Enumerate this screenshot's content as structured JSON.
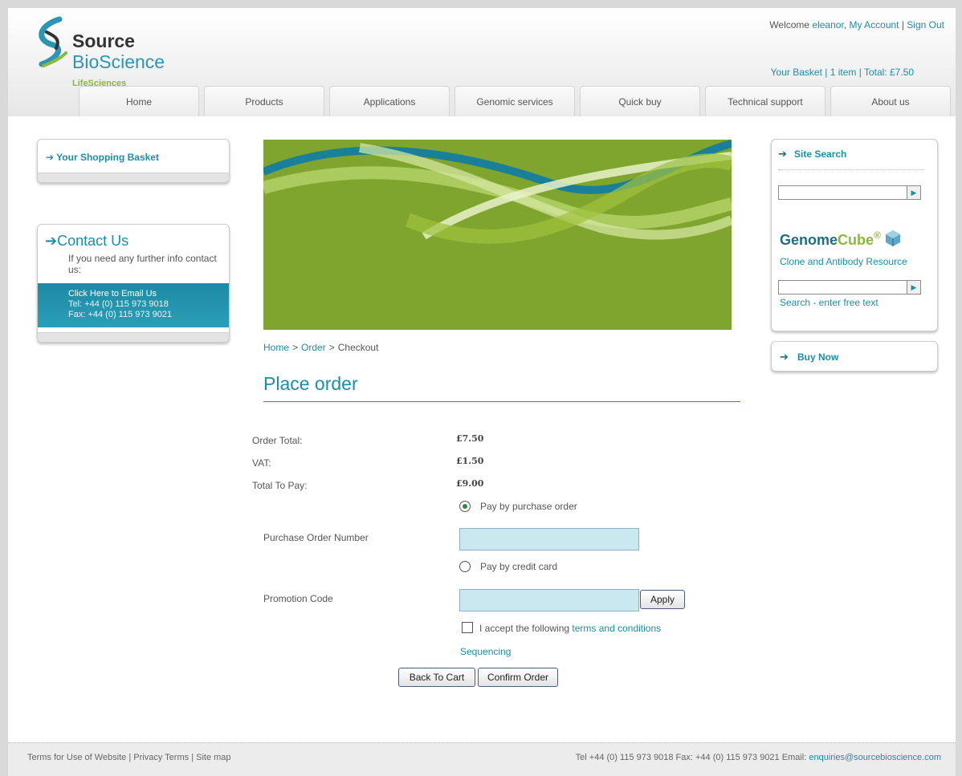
{
  "header": {
    "logo": {
      "line1": "Source",
      "line2": "BioScience",
      "line3": "LifeSciences"
    },
    "welcome_prefix": "Welcome ",
    "username": "eleanor",
    "my_account": "My Account",
    "separator": " | ",
    "sign_out": "Sign Out",
    "basket_summary": "Your Basket | 1 item | Total: £7.50"
  },
  "nav": {
    "items": [
      "Home",
      "Products",
      "Applications",
      "Genomic services",
      "Quick buy",
      "Technical support",
      "About us"
    ]
  },
  "left": {
    "basket_title": "Your Shopping Basket",
    "contact": {
      "title": "Contact Us",
      "desc": "If you need any further info contact us:",
      "email_link": "Click Here to Email Us",
      "tel": "Tel: +44 (0) 115 973 9018",
      "fax": "Fax: +44 (0) 115 973 9021"
    }
  },
  "breadcrumb": {
    "home": "Home",
    "order": "Order",
    "current": "Checkout",
    "sep": ">"
  },
  "main": {
    "title": "Place order",
    "order_total_label": "Order Total:",
    "order_total_value": "£7.50",
    "vat_label": "VAT:",
    "vat_value": "£1.50",
    "total_label": "Total To Pay:",
    "total_value": "£9.00",
    "pay_po_label": "Pay by purchase order",
    "po_number_label": "Purchase Order Number",
    "po_number_value": "",
    "pay_cc_label": "Pay by credit card",
    "promo_label": "Promotion Code",
    "promo_value": "",
    "apply_label": "Apply",
    "accept_text": "I accept the following ",
    "terms_link": "terms and conditions",
    "sequencing_link": "Sequencing",
    "back_label": "Back To Cart",
    "confirm_label": "Confirm Order",
    "selected_payment": "purchase order",
    "terms_accepted": false
  },
  "right": {
    "site_search_title": "Site Search",
    "site_search_value": "",
    "genomecube_part1": "Genome",
    "genomecube_part2": "Cube",
    "genomecube_reg": "®",
    "genomecube_sub": "Clone and Antibody Resource",
    "genomecube_value": "",
    "genomecube_hint": "Search - enter free text",
    "buy_now": "Buy Now"
  },
  "footer": {
    "terms": "Terms for Use of Website",
    "privacy": "Privacy Terms",
    "sitemap": "Site map",
    "sep": " | ",
    "contact_text": "Tel +44 (0) 115 973 9018 Fax: +44 (0) 115 973 9021 Email: ",
    "email": "enquiries@sourcebioscience.com"
  },
  "colors": {
    "accent": "#1a8fa6",
    "banner_green": "#7fa52e",
    "brand_green": "#8db63c"
  }
}
